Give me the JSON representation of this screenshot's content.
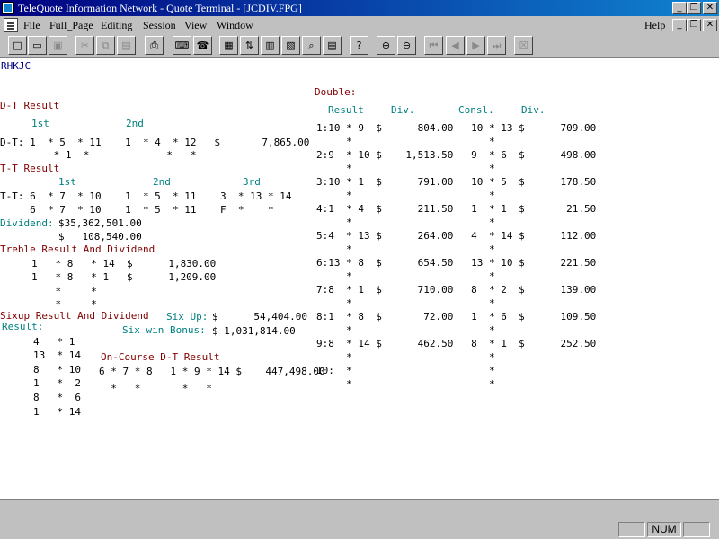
{
  "window": {
    "title": "TeleQuote Information Network - Quote Terminal - [JCDIV.FPG]"
  },
  "menu": {
    "items": [
      "File",
      "Full_Page",
      "Editing",
      "Session",
      "View",
      "Window"
    ],
    "help": "Help"
  },
  "toolbar": {
    "buttons": [
      {
        "icon": "new-document-icon",
        "glyph": "□"
      },
      {
        "icon": "open-folder-icon",
        "glyph": "▭"
      },
      {
        "icon": "save-icon",
        "glyph": "▣"
      },
      {
        "icon": "cut-icon",
        "glyph": "✂"
      },
      {
        "icon": "copy-icon",
        "glyph": "⧉"
      },
      {
        "icon": "paste-icon",
        "glyph": "▤"
      },
      {
        "icon": "print-icon",
        "glyph": "⎙"
      },
      {
        "icon": "keyboard-icon",
        "glyph": "⌨"
      },
      {
        "icon": "phone-icon",
        "glyph": "☎"
      },
      {
        "icon": "grid-icon",
        "glyph": "▦"
      },
      {
        "icon": "ticker-icon",
        "glyph": "⇅"
      },
      {
        "icon": "chart-icon",
        "glyph": "▥"
      },
      {
        "icon": "live-icon",
        "glyph": "▧"
      },
      {
        "icon": "inspect-icon",
        "glyph": "⌕"
      },
      {
        "icon": "table-icon",
        "glyph": "▤"
      },
      {
        "icon": "help-icon",
        "glyph": "?"
      },
      {
        "icon": "zoom-in-icon",
        "glyph": "⊕"
      },
      {
        "icon": "zoom-out-icon",
        "glyph": "⊖"
      },
      {
        "icon": "first-page-icon",
        "glyph": "⏮"
      },
      {
        "icon": "prev-page-icon",
        "glyph": "◀"
      },
      {
        "icon": "next-page-icon",
        "glyph": "▶"
      },
      {
        "icon": "last-page-icon",
        "glyph": "⏭"
      },
      {
        "icon": "close-page-icon",
        "glyph": "☒"
      }
    ]
  },
  "page": {
    "code": "RHKJC",
    "dt": {
      "title": "D-T Result",
      "h1": "1st",
      "h2": "2nd",
      "row1": "D-T: 1  * 5  * 11    1  * 4  * 12   $       7,865.00",
      "row2": "         * 1  *             *   *"
    },
    "tt": {
      "title": "T-T Result",
      "h1": "1st",
      "h2": "2nd",
      "h3": "3rd",
      "row1": "T-T: 6  * 7  * 10    1  * 5  * 11    3  * 13 * 14",
      "row2": "     6  * 7  * 10    1  * 5  * 11    F  *    *",
      "dividend_label": "Dividend:",
      "dividend1": "$35,362,501.00",
      "dividend2": "$   108,540.00"
    },
    "treble": {
      "title": "Treble Result And Dividend",
      "row1": "1   * 8   * 14  $      1,830.00",
      "row2": "1   * 8   * 1   $      1,209.00",
      "row3": "    *     *",
      "row4": "    *     *"
    },
    "sixup": {
      "title": "Sixup Result And Dividend",
      "sixup_label": "Six Up:",
      "sixup_value": "$      54,404.00",
      "result_label": "Result:",
      "bonus_label": "Six win Bonus:",
      "bonus_value": "$ 1,031,814.00",
      "lines": [
        "4   * 1",
        "13  * 14",
        "8   * 10",
        "1   *  2",
        "8   *  6",
        "1   * 14"
      ]
    },
    "oncourse": {
      "title": "On-Course D-T Result",
      "row1": "6 * 7 * 8   1 * 9 * 14 $    447,498.00",
      "row2": "  *   *       *   *"
    },
    "double": {
      "title": "Double:",
      "headers": [
        "Result",
        "Div.",
        "Consl.",
        "Div."
      ],
      "rows": [
        {
          "line": "1:10 * 9  $      804.00   10 * 13 $      709.00",
          "sub": "     *                       *"
        },
        {
          "line": "2:9  * 10 $    1,513.50   9  * 6  $      498.00",
          "sub": "     *                       *"
        },
        {
          "line": "3:10 * 1  $      791.00   10 * 5  $      178.50",
          "sub": "     *                       *"
        },
        {
          "line": "4:1  * 4  $      211.50   1  * 1  $       21.50",
          "sub": "     *                       *"
        },
        {
          "line": "5:4  * 13 $      264.00   4  * 14 $      112.00",
          "sub": "     *                       *"
        },
        {
          "line": "6:13 * 8  $      654.50   13 * 10 $      221.50",
          "sub": "     *                       *"
        },
        {
          "line": "7:8  * 1  $      710.00   8  * 2  $      139.00",
          "sub": "     *                       *"
        },
        {
          "line": "8:1  * 8  $       72.00   1  * 6  $      109.50",
          "sub": "     *                       *"
        },
        {
          "line": "9:8  * 14 $      462.50   8  * 1  $      252.50",
          "sub": "     *                       *"
        },
        {
          "line": "10:  *                       *",
          "sub": "     *                       *"
        }
      ]
    }
  },
  "status": {
    "num": "NUM"
  }
}
